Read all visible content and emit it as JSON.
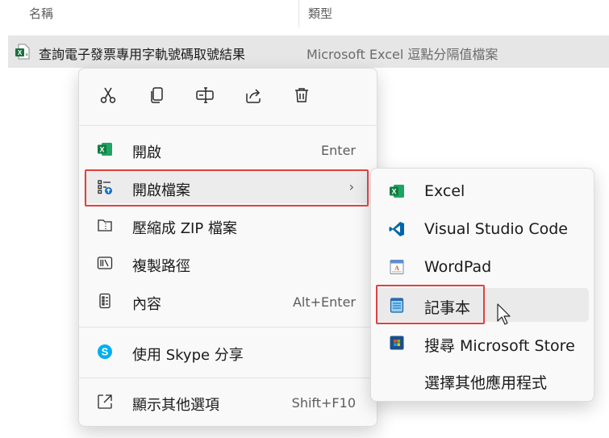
{
  "columns": {
    "name": "名稱",
    "type": "類型"
  },
  "file": {
    "name": "查詢電子發票專用字軌號碼取號結果",
    "type": "Microsoft Excel 逗點分隔值檔案",
    "icon": "excel-csv-icon"
  },
  "context_menu": {
    "toolbar": [
      {
        "name": "cut-icon"
      },
      {
        "name": "copy-icon"
      },
      {
        "name": "rename-icon"
      },
      {
        "name": "share-icon"
      },
      {
        "name": "delete-icon"
      }
    ],
    "items": {
      "open": {
        "label": "開啟",
        "shortcut": "Enter",
        "icon": "excel-icon"
      },
      "open_with": {
        "label": "開啟檔案",
        "icon": "open-with-icon"
      },
      "compress": {
        "label": "壓縮成 ZIP 檔案",
        "icon": "zip-icon"
      },
      "copy_path": {
        "label": "複製路徑",
        "icon": "copy-path-icon"
      },
      "properties": {
        "label": "內容",
        "shortcut": "Alt+Enter",
        "icon": "properties-icon"
      },
      "skype": {
        "label": "使用 Skype 分享",
        "icon": "skype-icon"
      },
      "more": {
        "label": "顯示其他選項",
        "shortcut": "Shift+F10",
        "icon": "more-options-icon"
      }
    }
  },
  "submenu": {
    "items": [
      {
        "label": "Excel",
        "icon": "excel-icon"
      },
      {
        "label": "Visual Studio Code",
        "icon": "vscode-icon"
      },
      {
        "label": "WordPad",
        "icon": "wordpad-icon"
      },
      {
        "label": "記事本",
        "icon": "notepad-icon"
      },
      {
        "label": "搜尋 Microsoft Store",
        "icon": "store-icon"
      },
      {
        "label": "選擇其他應用程式",
        "icon": ""
      }
    ]
  },
  "colors": {
    "excel": "#1d6f42",
    "skype": "#00aff0",
    "vscode": "#0065a9",
    "highlight": "#e04040"
  }
}
